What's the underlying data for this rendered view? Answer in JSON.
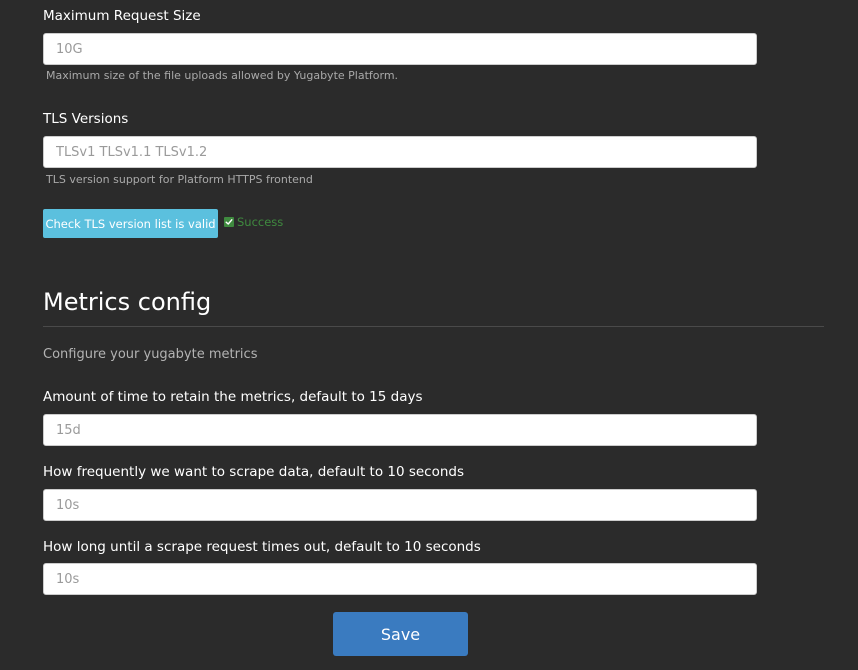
{
  "fields": {
    "max_request_size": {
      "label": "Maximum Request Size",
      "value": "10G",
      "help": "Maximum size of the file uploads allowed by Yugabyte Platform."
    },
    "tls_versions": {
      "label": "TLS Versions",
      "value": "TLSv1 TLSv1.1 TLSv1.2",
      "help": "TLS version support for Platform HTTPS frontend"
    }
  },
  "tls_check": {
    "button_label": "Check TLS version list is valid",
    "status_text": "Success",
    "status_icon": "checkbox-checked-icon",
    "button_color": "#5bc0de",
    "status_color": "#3f8a3f"
  },
  "metrics": {
    "title": "Metrics config",
    "description": "Configure your yugabyte metrics",
    "retention": {
      "label": "Amount of time to retain the metrics, default to 15 days",
      "value": "15d"
    },
    "scrape_interval": {
      "label": "How frequently we want to scrape data, default to 10 seconds",
      "value": "10s"
    },
    "scrape_timeout": {
      "label": "How long until a scrape request times out, default to 10 seconds",
      "value": "10s"
    }
  },
  "save": {
    "label": "Save",
    "color": "#3a7bc0"
  },
  "theme": {
    "background": "#2b2b2b"
  }
}
